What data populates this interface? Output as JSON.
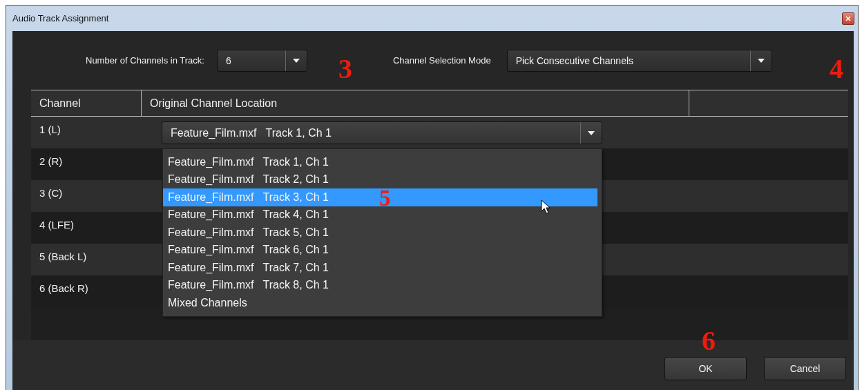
{
  "window": {
    "title": "Audio Track Assignment"
  },
  "channel_count": {
    "label": "Number of Channels in Track:",
    "value": "6"
  },
  "selection_mode": {
    "label": "Channel Selection Mode",
    "value": "Pick Consecutive Channels"
  },
  "table": {
    "columns": [
      "Channel",
      "Original Channel Location"
    ],
    "rows": [
      {
        "channel": "1 (L)",
        "location": "Feature_Film.mxf   Track 1, Ch 1"
      },
      {
        "channel": "2 (R)"
      },
      {
        "channel": "3 (C)"
      },
      {
        "channel": "4 (LFE)"
      },
      {
        "channel": "5 (Back L)"
      },
      {
        "channel": "6 (Back R)"
      }
    ]
  },
  "dropdown": {
    "options": [
      {
        "label": "Feature_Film.mxf   Track 1, Ch 1",
        "selected": false
      },
      {
        "label": "Feature_Film.mxf   Track 2, Ch 1",
        "selected": false
      },
      {
        "label": "Feature_Film.mxf   Track 3, Ch 1",
        "selected": true,
        "callout": "5"
      },
      {
        "label": "Feature_Film.mxf   Track 4, Ch 1",
        "selected": false
      },
      {
        "label": "Feature_Film.mxf   Track 5, Ch 1",
        "selected": false
      },
      {
        "label": "Feature_Film.mxf   Track 6, Ch 1",
        "selected": false
      },
      {
        "label": "Feature_Film.mxf   Track 7, Ch 1",
        "selected": false
      },
      {
        "label": "Feature_Film.mxf   Track 8, Ch 1",
        "selected": false
      },
      {
        "label": "Mixed Channels",
        "selected": false
      }
    ]
  },
  "buttons": [
    "OK",
    "Cancel"
  ],
  "callouts": [
    "3",
    "4",
    "6"
  ]
}
